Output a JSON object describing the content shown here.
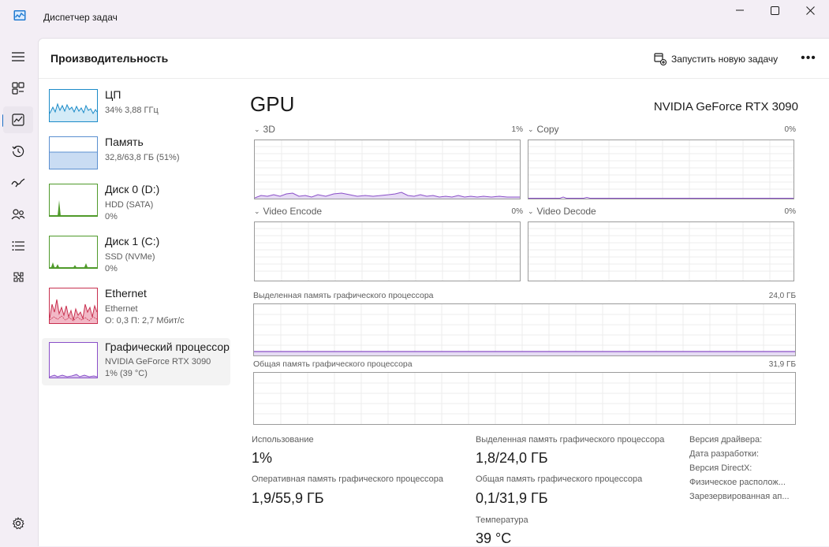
{
  "window": {
    "title": "Диспетчер задач",
    "accent": "#1d6fc4"
  },
  "nav": {
    "items": [
      "hamburger-icon",
      "processes-icon",
      "performance-icon",
      "app-history-icon",
      "startup-icon",
      "users-icon",
      "details-icon",
      "services-icon",
      "settings-icon"
    ],
    "active": "performance-icon"
  },
  "header": {
    "title": "Производительность",
    "run_task_label": "Запустить новую задачу",
    "more_label": "•••"
  },
  "resources": [
    {
      "name": "ЦП",
      "line1": "34% 3,88 ГГц",
      "line2": "",
      "color": "#1b8bc8"
    },
    {
      "name": "Память",
      "line1": "32,8/63,8 ГБ (51%)",
      "line2": "",
      "color": "#5a8fd0"
    },
    {
      "name": "Диск 0 (D:)",
      "line1": "HDD (SATA)",
      "line2": "0%",
      "color": "#4f9a2a"
    },
    {
      "name": "Диск 1 (C:)",
      "line1": "SSD (NVMe)",
      "line2": "0%",
      "color": "#4f9a2a"
    },
    {
      "name": "Ethernet",
      "line1": "Ethernet",
      "line2": "О: 0,3 П: 2,7 Мбит/с",
      "color": "#c8304f"
    },
    {
      "name": "Графический процессор",
      "line1": "NVIDIA GeForce RTX 3090",
      "line2": "1% (39 °C)",
      "color": "#8a4fc8"
    }
  ],
  "detail": {
    "title": "GPU",
    "model": "NVIDIA GeForce RTX 3090",
    "engines": [
      {
        "label": "3D",
        "percent": "1%"
      },
      {
        "label": "Copy",
        "percent": "0%"
      },
      {
        "label": "Video Encode",
        "percent": "0%"
      },
      {
        "label": "Video Decode",
        "percent": "0%"
      }
    ],
    "dedicated_label": "Выделенная память графического процессора",
    "dedicated_cap": "24,0 ГБ",
    "shared_label": "Общая память графического процессора",
    "shared_cap": "31,9 ГБ",
    "stats": {
      "usage_label": "Использование",
      "usage_value": "1%",
      "ram_label": "Оперативная память графического процессора",
      "ram_value": "1,9/55,9 ГБ",
      "dedicated_label": "Выделенная память графического процессора",
      "dedicated_value": "1,8/24,0 ГБ",
      "shared_label": "Общая память графического процессора",
      "shared_value": "0,1/31,9 ГБ",
      "temp_label": "Температура",
      "temp_value": "39 °C"
    },
    "info_labels": [
      "Версия драйвера:",
      "Дата разработки:",
      "Версия DirectX:",
      "Физическое располож...",
      "Зарезервированная ап..."
    ]
  },
  "colors": {
    "gpu": "#8a4fc8",
    "cpu": "#1b8bc8",
    "memory": "#5a8fd0",
    "disk": "#4f9a2a",
    "ethernet": "#c8304f"
  }
}
